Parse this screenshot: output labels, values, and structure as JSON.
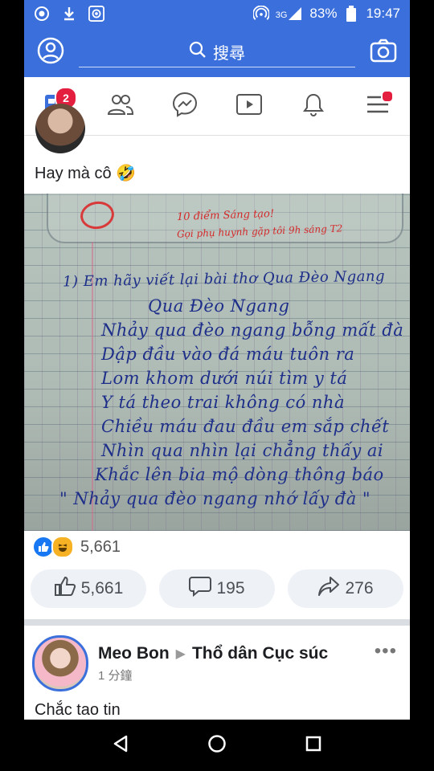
{
  "status_bar": {
    "network": "3G",
    "battery": "83%",
    "time": "19:47"
  },
  "search": {
    "placeholder": "搜尋"
  },
  "nav": {
    "items": [
      {
        "icon": "news-feed-icon",
        "badge": "2"
      },
      {
        "icon": "friends-icon"
      },
      {
        "icon": "messenger-icon"
      },
      {
        "icon": "watch-icon"
      },
      {
        "icon": "notifications-icon"
      },
      {
        "icon": "menu-icon",
        "dot": true
      }
    ]
  },
  "post1": {
    "text": "Hay mà cô 🤣",
    "image_text": {
      "grade": "0",
      "red_note_1": "10 điểm Sáng tạo!",
      "red_note_2": "Gọi phụ huynh gặp tôi 9h sáng T2",
      "lines": [
        "1) Em hãy viết lại bài thơ Qua Đèo Ngang",
        "Qua Đèo Ngang",
        "Nhảy qua đèo ngang bỗng mất đà",
        "Dập đầu vào đá máu tuôn ra",
        "Lom khom dưới núi tìm y tá",
        "Y tá theo trai không có nhà",
        "Chiều máu đau đầu em sắp chết",
        "Nhìn qua nhìn lại chẳng thấy ai",
        "Khắc lên bia mộ dòng thông báo",
        "\" Nhảy qua đèo ngang nhớ lấy đà \""
      ]
    },
    "reaction_count": "5,661",
    "like_count": "5,661",
    "comment_count": "195",
    "share_count": "276"
  },
  "post2": {
    "author": "Meo Bon",
    "group": "Thổ dân Cục súc",
    "time": "1 分鐘",
    "text": "Chắc tao tin"
  },
  "colors": {
    "brand": "#3a6fdc",
    "badge": "#e41e3f",
    "ink": "#1e2f8a",
    "red_ink": "#d32a2a"
  }
}
